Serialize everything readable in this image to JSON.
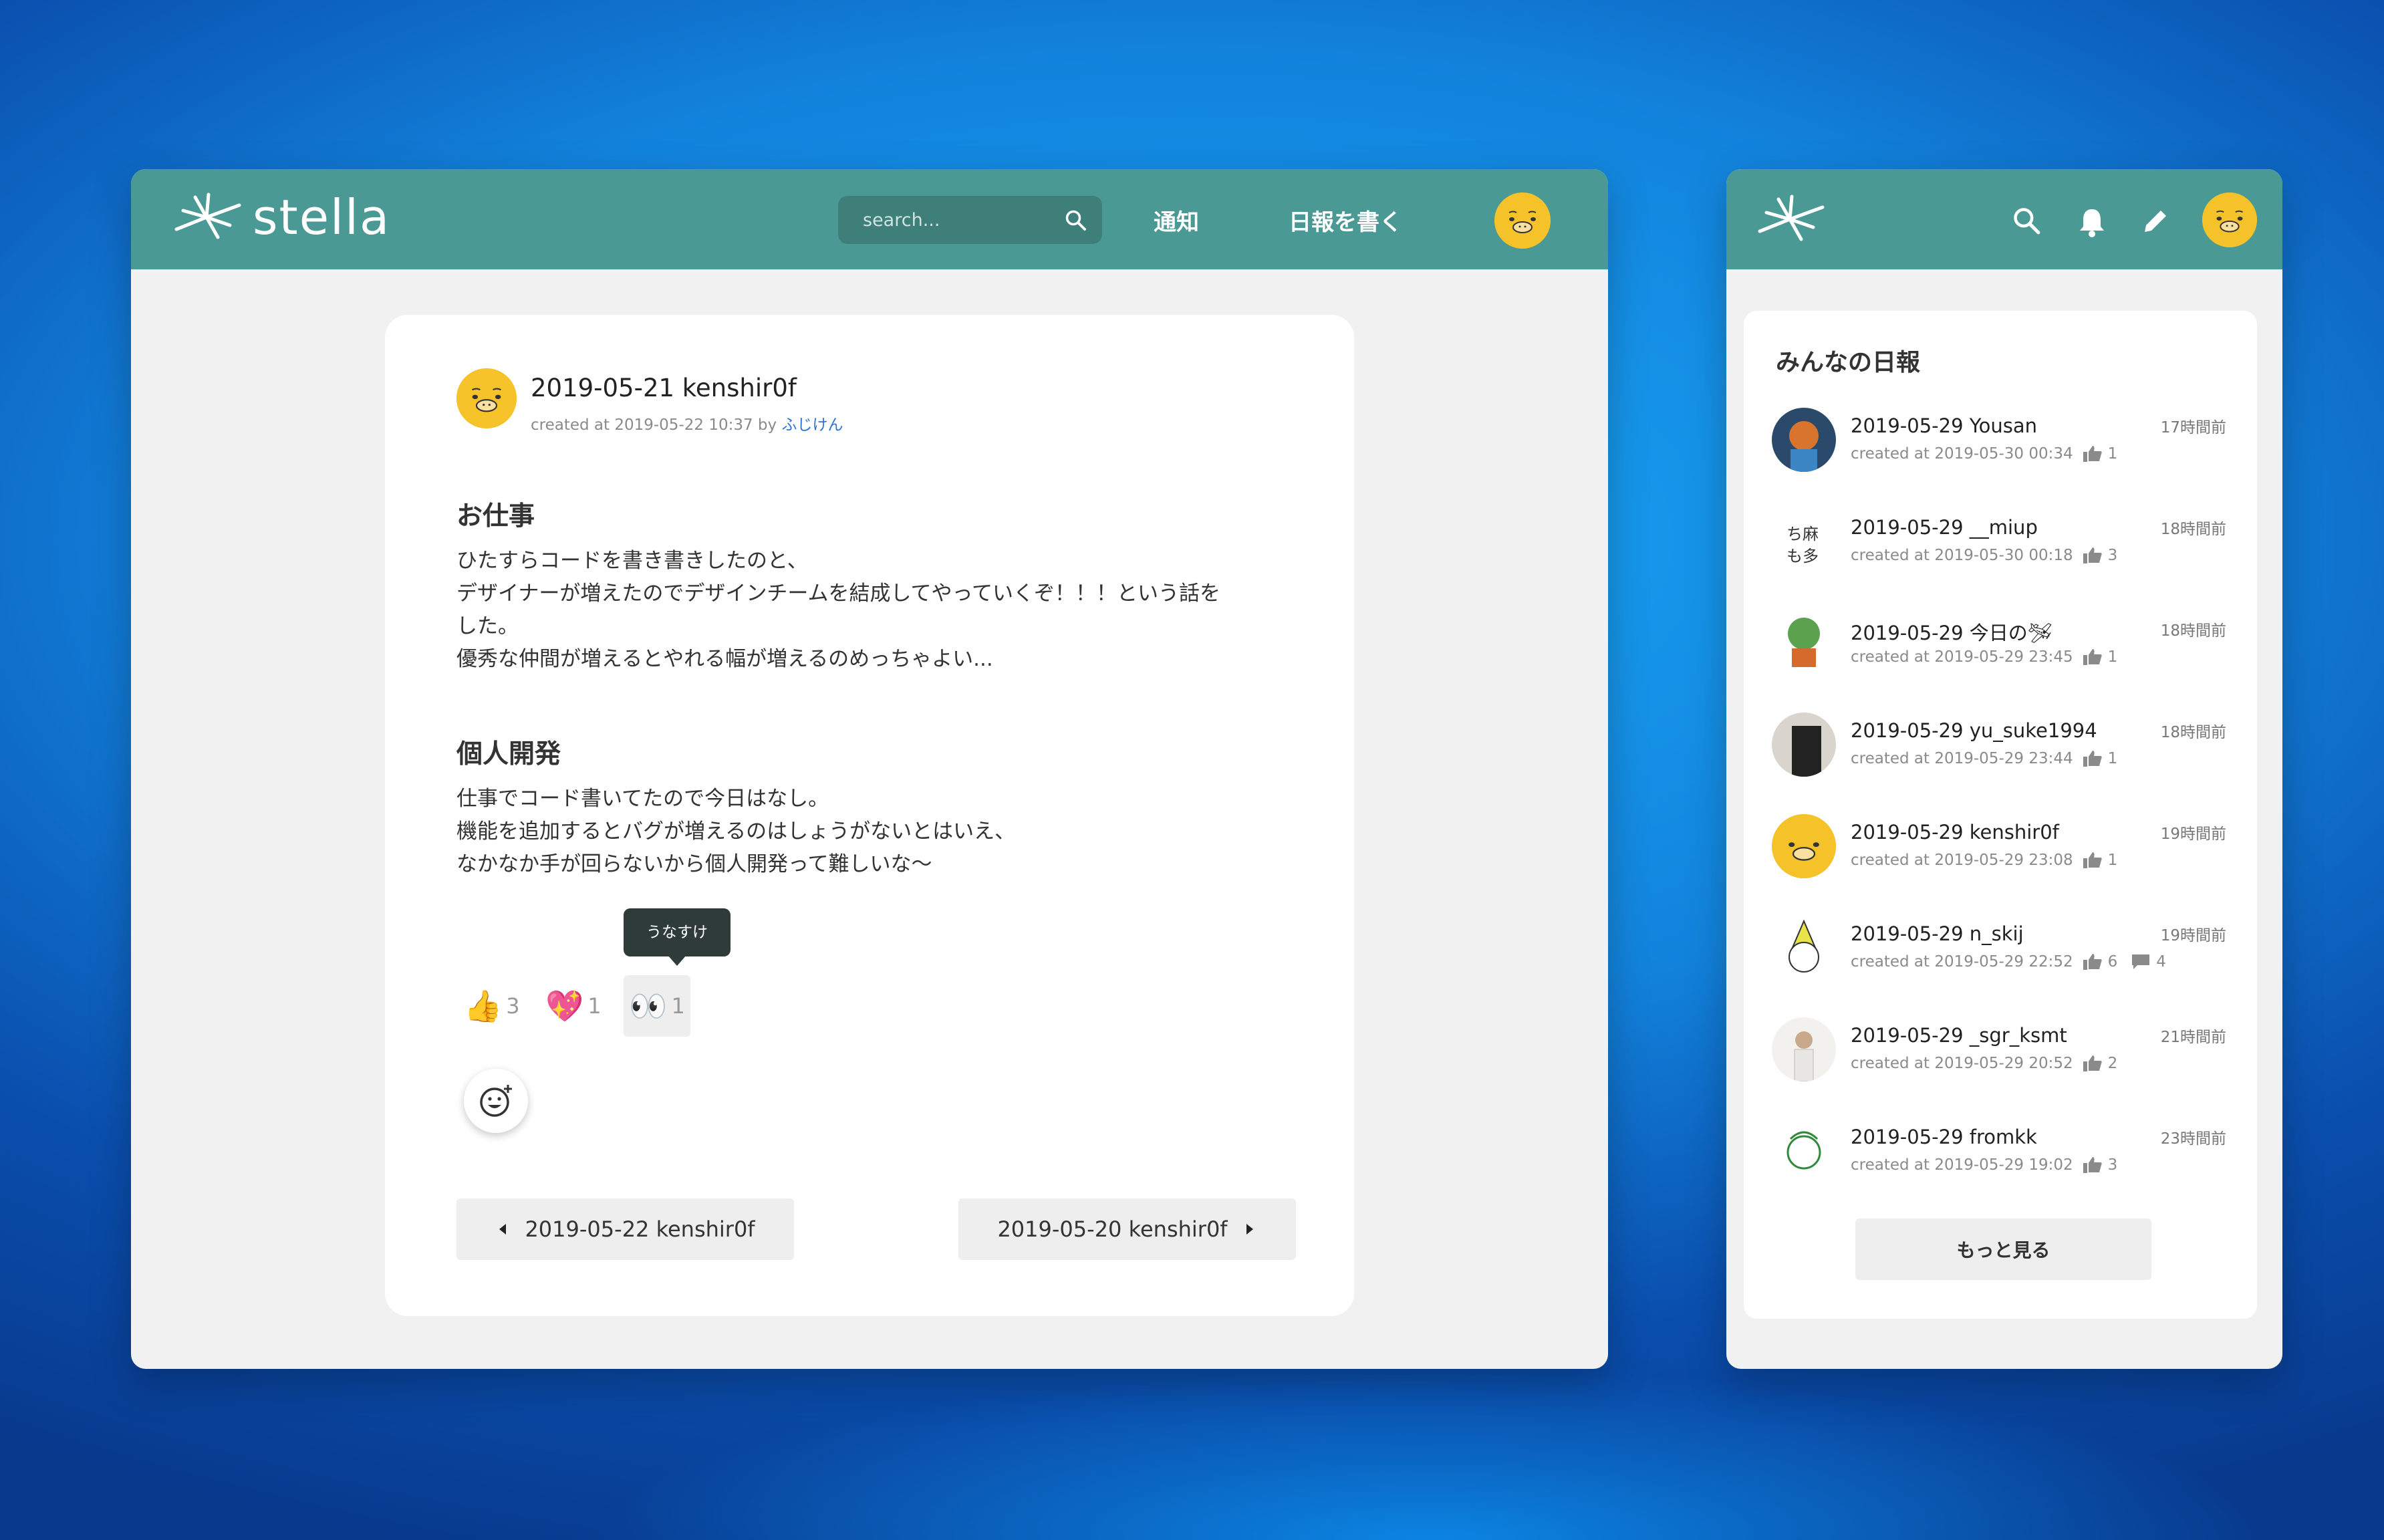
{
  "brand": {
    "name": "stella"
  },
  "header": {
    "search_placeholder": "search...",
    "notify_label": "通知",
    "write_label": "日報を書く"
  },
  "post": {
    "title": "2019-05-21 kenshir0f",
    "meta_prefix": "created at 2019-05-22 10:37 by ",
    "meta_author": "ふじけん",
    "sections": [
      {
        "heading": "お仕事",
        "lines": [
          "ひたすらコードを書き書きしたのと、",
          "デザイナーが増えたのでデザインチームを結成してやっていくぞ！！！という話を",
          "した。",
          "優秀な仲間が増えるとやれる幅が増えるのめっちゃよい..."
        ]
      },
      {
        "heading": "個人開発",
        "lines": [
          "仕事でコード書いてたので今日はなし。",
          "機能を追加するとバグが増えるのはしょうがないとはいえ、",
          "なかなか手が回らないから個人開発って難しいな〜"
        ]
      }
    ],
    "tooltip": "うなすけ",
    "reactions": [
      {
        "emoji": "👍",
        "count": "3"
      },
      {
        "emoji": "💖",
        "count": "1"
      },
      {
        "emoji": "👀",
        "count": "1"
      }
    ],
    "prev_label": "2019-05-22 kenshir0f",
    "next_label": "2019-05-20 kenshir0f"
  },
  "feed": {
    "heading": "みんなの日報",
    "more_label": "もっと見る",
    "items": [
      {
        "title": "2019-05-29 Yousan",
        "created": "created at 2019-05-30 00:34",
        "likes": "1",
        "comments": "",
        "time": "17時間前"
      },
      {
        "title": "2019-05-29 __miup",
        "created": "created at 2019-05-30 00:18",
        "likes": "3",
        "comments": "",
        "time": "18時間前"
      },
      {
        "title": "2019-05-29 今日の🛩",
        "created": "created at 2019-05-29 23:45",
        "likes": "1",
        "comments": "",
        "time": "18時間前"
      },
      {
        "title": "2019-05-29 yu_suke1994",
        "created": "created at 2019-05-29 23:44",
        "likes": "1",
        "comments": "",
        "time": "18時間前"
      },
      {
        "title": "2019-05-29 kenshir0f",
        "created": "created at 2019-05-29 23:08",
        "likes": "1",
        "comments": "",
        "time": "19時間前"
      },
      {
        "title": "2019-05-29 n_skij",
        "created": "created at 2019-05-29 22:52",
        "likes": "6",
        "comments": "4",
        "time": "19時間前"
      },
      {
        "title": "2019-05-29 _sgr_ksmt",
        "created": "created at 2019-05-29 20:52",
        "likes": "2",
        "comments": "",
        "time": "21時間前"
      },
      {
        "title": "2019-05-29 fromkk",
        "created": "created at 2019-05-29 19:02",
        "likes": "3",
        "comments": "",
        "time": "23時間前"
      }
    ]
  }
}
